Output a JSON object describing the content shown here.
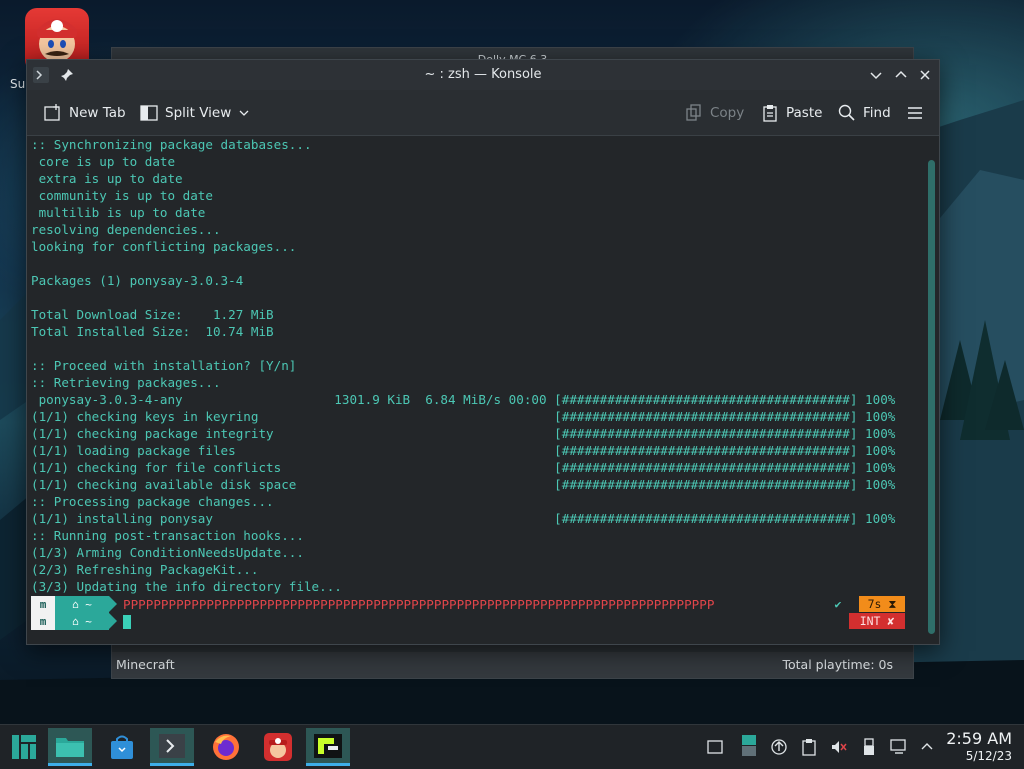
{
  "desktop": {
    "icon_label": "Su"
  },
  "background_window": {
    "title": "Dolly MC 6.3",
    "status_left": "Minecraft",
    "status_right": "Total playtime: 0s"
  },
  "konsole": {
    "title": "~ : zsh — Konsole",
    "toolbar": {
      "new_tab": "New Tab",
      "split_view": "Split View",
      "copy": "Copy",
      "paste": "Paste",
      "find": "Find"
    },
    "lines": [
      ":: Synchronizing package databases...",
      " core is up to date",
      " extra is up to date",
      " community is up to date",
      " multilib is up to date",
      "resolving dependencies...",
      "looking for conflicting packages...",
      "",
      "Packages (1) ponysay-3.0.3-4",
      "",
      "Total Download Size:    1.27 MiB",
      "Total Installed Size:  10.74 MiB",
      "",
      ":: Proceed with installation? [Y/n]",
      ":: Retrieving packages...",
      " ponysay-3.0.3-4-any                    1301.9 KiB  6.84 MiB/s 00:00 [######################################] 100%",
      "(1/1) checking keys in keyring                                       [######################################] 100%",
      "(1/1) checking package integrity                                     [######################################] 100%",
      "(1/1) loading package files                                          [######################################] 100%",
      "(1/1) checking for file conflicts                                    [######################################] 100%",
      "(1/1) checking available disk space                                  [######################################] 100%",
      ":: Processing package changes...",
      "(1/1) installing ponysay                                             [######################################] 100%",
      ":: Running post-transaction hooks...",
      "(1/3) Arming ConditionNeedsUpdate...",
      "(2/3) Refreshing PackageKit...",
      "(3/3) Updating the info directory file..."
    ],
    "prompt": {
      "os_glyph": "m",
      "dir": "⌂ ~",
      "typed_line": "PPPPPPPPPPPPPPPPPPPPPPPPPPPPPPPPPPPPPPPPPPPPPPPPPPPPPPPPPPPPPPPPPPPPPPPPPPPPPP",
      "check": "✔",
      "duration": "7s ⧗",
      "interrupt": "INT ✘"
    }
  },
  "taskbar": {
    "time": "2:59 AM",
    "date": "5/12/23"
  },
  "colors": {
    "terminal_text": "#4cc7b4",
    "accent": "#2ba89a",
    "error": "#e0454a",
    "warning": "#f28c1a"
  }
}
